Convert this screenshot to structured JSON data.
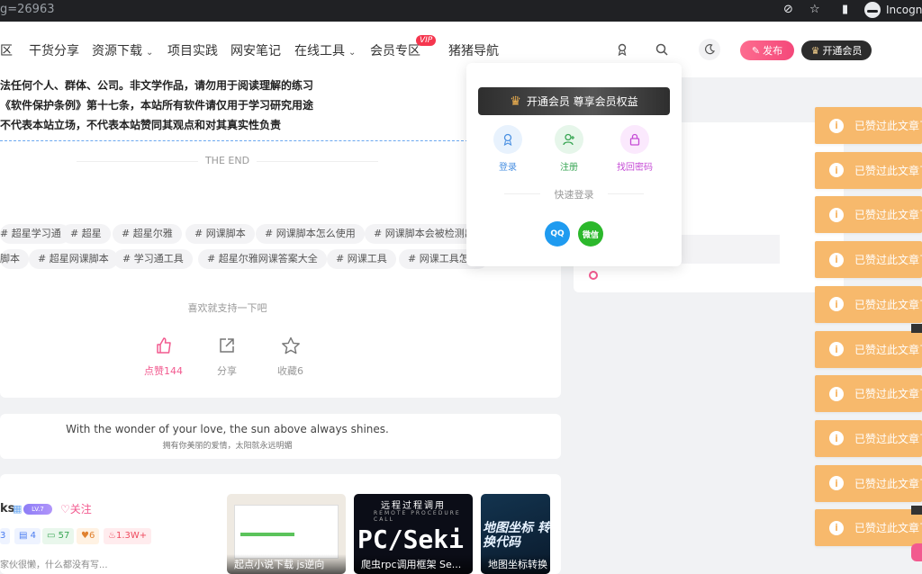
{
  "browser": {
    "url_fragment": "g=26963",
    "incognito_label": "Incogni"
  },
  "nav": {
    "items": [
      {
        "label": "区"
      },
      {
        "label": "干货分享"
      },
      {
        "label": "资源下载",
        "dropdown": true
      },
      {
        "label": "项目实践"
      },
      {
        "label": "网安笔记"
      },
      {
        "label": "在线工具",
        "dropdown": true
      },
      {
        "label": "会员专区"
      },
      {
        "label": "猪猪导航"
      }
    ],
    "vip_badge": "VIP",
    "publish_label": "发布",
    "open_vip_label": "开通会员"
  },
  "article": {
    "notices": [
      "法任何个人、群体、公司。非文学作品，请勿用于阅读理解的练习",
      "《软件保护条例》第十七条，本站所有软件请仅用于学习研究用途",
      "不代表本站立场，不代表本站赞同其观点和对其真实性负责"
    ],
    "the_end": "THE END",
    "tags_row1": [
      "# 超星学习通",
      "# 超星",
      "# 超星尔雅",
      "# 网课脚本",
      "# 网课脚本怎么使用",
      "# 网课脚本会被检测出"
    ],
    "tags_row2": [
      "脚本",
      "# 超星网课脚本",
      "# 学习通工具",
      "# 超星尔雅网课答案大全",
      "# 网课工具",
      "# 网课工具怎么"
    ],
    "support_text": "喜欢就支持一下吧",
    "like_label": "点赞144",
    "share_label": "分享",
    "favorite_label": "收藏6"
  },
  "quote": {
    "en": "With the wonder of your love, the sun above always shines.",
    "cn": "拥有你美丽的爱情，太阳就永远明媚"
  },
  "author": {
    "name": "ks",
    "level": "LV.7",
    "follow_label": "关注",
    "stats": [
      {
        "label": "3",
        "color": "#4a7cf0",
        "bg": "#eef3ff"
      },
      {
        "label": "4",
        "color": "#4a7cf0",
        "bg": "#eef3ff"
      },
      {
        "label": "57",
        "color": "#3aa655",
        "bg": "#e9f7ec"
      },
      {
        "label": "6",
        "color": "#e0812f",
        "bg": "#fff2e3"
      },
      {
        "label": "1.3W+",
        "color": "#ef4a5e",
        "bg": "#ffecee"
      }
    ],
    "description": "家伙很懒，什么都没有写...",
    "posts": [
      {
        "caption": "起点小说下载 js逆向"
      },
      {
        "caption": "爬虫rpc调用框架 Se...",
        "t1": "远程过程调用",
        "t2": "REMOTE PROCEDURE CALL",
        "big": "PC/Seki"
      },
      {
        "caption": "地图坐标转换",
        "big": "地图坐标 转换代码"
      }
    ]
  },
  "login_dropdown": {
    "vip_banner": "开通会员 尊享会员权益",
    "login_label": "登录",
    "register_label": "注册",
    "recover_label": "找回密码",
    "quick_login": "快速登录",
    "qq_icon_text": "QQ",
    "wechat_icon_text": "微信"
  },
  "toasts": {
    "message": "已赞过此文章了",
    "count": 10
  },
  "colors": {
    "accent_pink": "#f25a8f",
    "toast_orange": "#f7b96c",
    "vip_red": "#f5364e"
  }
}
